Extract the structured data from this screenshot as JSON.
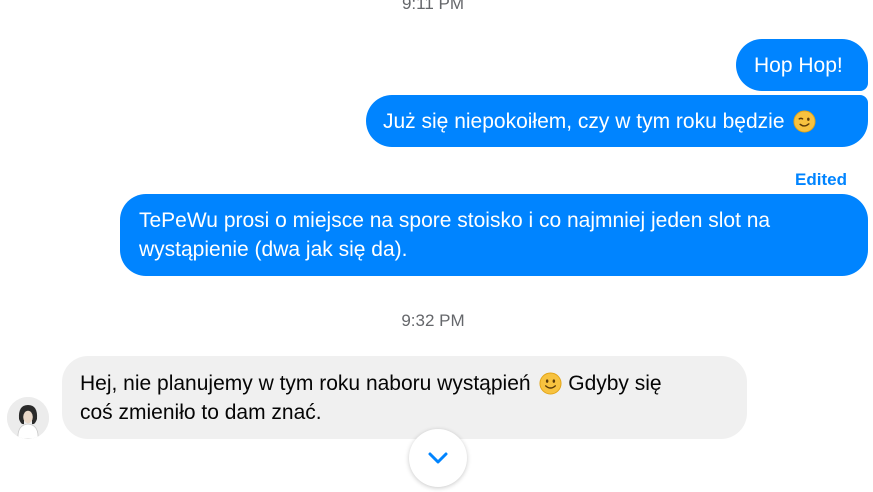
{
  "conversation": {
    "timestamps": [
      "9:11 PM",
      "9:32 PM"
    ],
    "edited_label": "Edited",
    "messages": [
      {
        "direction": "outgoing",
        "lines": [
          "Hop Hop!"
        ]
      },
      {
        "direction": "outgoing",
        "lines": [
          "Już się niepokoiłem, czy w tym roku będzie"
        ],
        "emoji": "winking-face"
      },
      {
        "direction": "outgoing",
        "lines": [
          "TePeWu prosi o miejsce na spore stoisko i co najmniej jeden slot na",
          "wystąpienie (dwa jak się da)."
        ]
      },
      {
        "direction": "incoming",
        "lines": [
          "Hej, nie planujemy w tym roku naboru wystąpień",
          "Gdyby się",
          "coś zmieniło to dam znać."
        ],
        "emoji": "smiling-face"
      }
    ]
  },
  "colors": {
    "outgoing_bubble": "#0084ff",
    "incoming_bubble": "#f0f0f0",
    "timestamp_text": "#65676b",
    "edited_label": "#0084ff"
  },
  "icons": {
    "avatar": "contact-avatar",
    "scroll_button": "scroll-to-bottom-icon"
  }
}
